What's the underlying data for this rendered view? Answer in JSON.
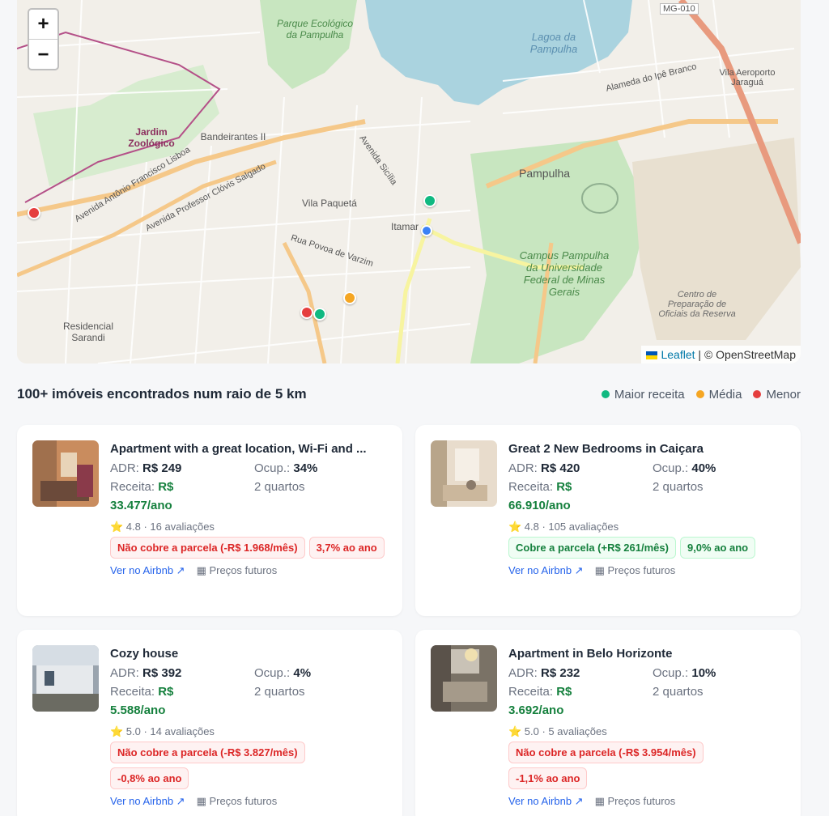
{
  "map": {
    "zoom_in": "+",
    "zoom_out": "−",
    "attribution_link": "Leaflet",
    "attribution_text": "| © OpenStreetMap",
    "labels": {
      "mg010": "MG-010",
      "lagoa": "Lagoa da Pampulha",
      "parque": "Parque Ecológico da Pampulha",
      "jardim": "Jardim Zoológico",
      "bandeirantes": "Bandeirantes II",
      "pampulha": "Pampulha",
      "vila_paqueta": "Vila Paquetá",
      "itamar": "Itamar",
      "campus": "Campus Pampulha da Universidade Federal de Minas Gerais",
      "centro": "Centro de Preparação de Oficiais da Reserva",
      "residencial": "Residencial Sarandi",
      "vila_aeroporto": "Vila Aeroporto Jaraguá",
      "alameda": "Alameda do Ipê Branco",
      "av_clovis": "Avenida Professor Clóvis Salgado",
      "av_sicilia": "Avenida Sicília",
      "rua_povoa": "Rua Povoa de Varzim",
      "av_antonio": "Avenida Antônio Francisco Lisboa"
    }
  },
  "results": {
    "title": "100+ imóveis encontrados num raio de 5 km",
    "legend": [
      {
        "label": "Maior receita",
        "color": "#10b981"
      },
      {
        "label": "Média",
        "color": "#f5a623"
      },
      {
        "label": "Menor",
        "color": "#e53e3e"
      }
    ]
  },
  "cards": [
    {
      "title": "Apartment with a great location, Wi-Fi and ...",
      "adr_label": "ADR:",
      "adr": "R$ 249",
      "occ_label": "Ocup.:",
      "occ": "34%",
      "rev_label": "Receita:",
      "rev_a": "R$",
      "rev_b": "33.477/ano",
      "rooms": "2 quartos",
      "rating": "⭐ 4.8 · 16 avaliações",
      "badge1": "Não cobre a parcela (-R$ 1.968/mês)",
      "badge2": "3,7% ao ano",
      "link_airbnb": "Ver no Airbnb ↗",
      "link_future": "▦ Preços futuros"
    },
    {
      "title": "Great 2 New Bedrooms in Caiçara",
      "adr_label": "ADR:",
      "adr": "R$ 420",
      "occ_label": "Ocup.:",
      "occ": "40%",
      "rev_label": "Receita:",
      "rev_a": "R$",
      "rev_b": "66.910/ano",
      "rooms": "2 quartos",
      "rating": "⭐ 4.8 · 105 avaliações",
      "badge1": "Cobre a parcela (+R$ 261/mês)",
      "badge2": "9,0% ao ano",
      "link_airbnb": "Ver no Airbnb ↗",
      "link_future": "▦ Preços futuros"
    },
    {
      "title": "Cozy house",
      "adr_label": "ADR:",
      "adr": "R$ 392",
      "occ_label": "Ocup.:",
      "occ": "4%",
      "rev_label": "Receita:",
      "rev_a": "R$",
      "rev_b": "5.588/ano",
      "rooms": "2 quartos",
      "rating": "⭐ 5.0 · 14 avaliações",
      "badge1": "Não cobre a parcela (-R$ 3.827/mês)",
      "badge2": "-0,8% ao ano",
      "link_airbnb": "Ver no Airbnb ↗",
      "link_future": "▦ Preços futuros"
    },
    {
      "title": "Apartment in Belo Horizonte",
      "adr_label": "ADR:",
      "adr": "R$ 232",
      "occ_label": "Ocup.:",
      "occ": "10%",
      "rev_label": "Receita:",
      "rev_a": "R$",
      "rev_b": "3.692/ano",
      "rooms": "2 quartos",
      "rating": "⭐ 5.0 · 5 avaliações",
      "badge1": "Não cobre a parcela (-R$ 3.954/mês)",
      "badge2": "-1,1% ao ano",
      "link_airbnb": "Ver no Airbnb ↗",
      "link_future": "▦ Preços futuros"
    }
  ]
}
